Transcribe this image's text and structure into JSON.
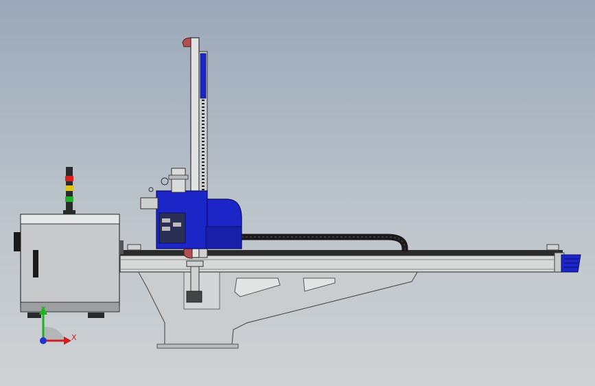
{
  "scene": {
    "background_top": "#9aa8b9",
    "background_bottom": "#cfd2d4"
  },
  "triad": {
    "x_label": "X",
    "y_label": "Y",
    "x_color": "#d11f1f",
    "y_color": "#1fb21f",
    "origin_color": "#2233cc"
  },
  "stack_light": {
    "lamps": [
      "#d92020",
      "#e3c21a",
      "#22b02b"
    ]
  },
  "colors": {
    "carriage_blue": "#1c25c8",
    "frame_gray": "#c9cbcc",
    "rail_gray": "#d7d8d8",
    "cable_chain": "#1a1a1a",
    "accent_red": "#b05050"
  }
}
